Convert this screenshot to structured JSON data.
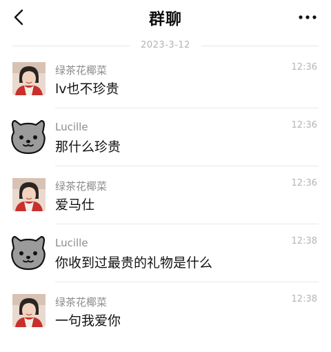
{
  "header": {
    "title": "群聊",
    "back_icon": "chevron-left-icon",
    "more_icon": "more-dots-icon"
  },
  "date_separator": "2023-3-12",
  "messages": [
    {
      "sender": "绿茶花椰菜",
      "avatar": "photo-avatar",
      "time": "12:36",
      "text": "lv也不珍贵"
    },
    {
      "sender": "Lucille",
      "avatar": "dog-avatar",
      "time": "12:36",
      "text": "那什么珍贵"
    },
    {
      "sender": "绿茶花椰菜",
      "avatar": "photo-avatar",
      "time": "12:36",
      "text": "爱马仕"
    },
    {
      "sender": "Lucille",
      "avatar": "dog-avatar",
      "time": "12:38",
      "text": "你收到过最贵的礼物是什么"
    },
    {
      "sender": "绿茶花椰菜",
      "avatar": "photo-avatar",
      "time": "12:38",
      "text": "一句我爱你"
    }
  ]
}
